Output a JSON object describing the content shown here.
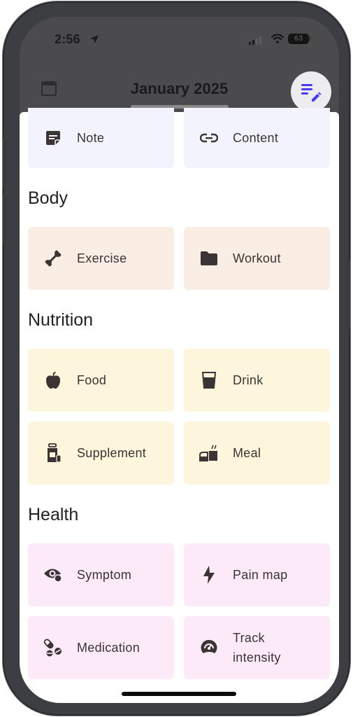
{
  "status_bar": {
    "time": "2:56",
    "battery": "63",
    "icons": [
      "location-arrow-icon",
      "signal-icon",
      "wifi-icon",
      "battery-icon"
    ]
  },
  "header": {
    "title": "January 2025",
    "left_icon": "calendar-icon",
    "action_icon": "edit-list-icon"
  },
  "colors": {
    "accent": "#4a3cf2",
    "journal_card": "#f2f3fc",
    "body_card": "#faede3",
    "nutrition_card": "#fdf5dc",
    "health_card": "#fdeaf8",
    "icon_text": "#3a3434"
  },
  "journal": {
    "items": [
      {
        "label": "Note",
        "icon": "note-icon"
      },
      {
        "label": "Content",
        "icon": "link-icon"
      }
    ]
  },
  "sections": {
    "body": {
      "title": "Body",
      "items": [
        {
          "label": "Exercise",
          "icon": "dumbbell-icon"
        },
        {
          "label": "Workout",
          "icon": "folder-icon"
        }
      ]
    },
    "nutrition": {
      "title": "Nutrition",
      "items": [
        {
          "label": "Food",
          "icon": "apple-icon"
        },
        {
          "label": "Drink",
          "icon": "glass-icon"
        },
        {
          "label": "Supplement",
          "icon": "supplement-bottle-icon"
        },
        {
          "label": "Meal",
          "icon": "meal-icon"
        }
      ]
    },
    "health": {
      "title": "Health",
      "items": [
        {
          "label": "Symptom",
          "icon": "eye-symptom-icon"
        },
        {
          "label": "Pain map",
          "icon": "bolt-icon"
        },
        {
          "label": "Medication",
          "icon": "pills-icon"
        },
        {
          "label": "Track intensity",
          "icon": "gauge-icon"
        }
      ]
    }
  }
}
